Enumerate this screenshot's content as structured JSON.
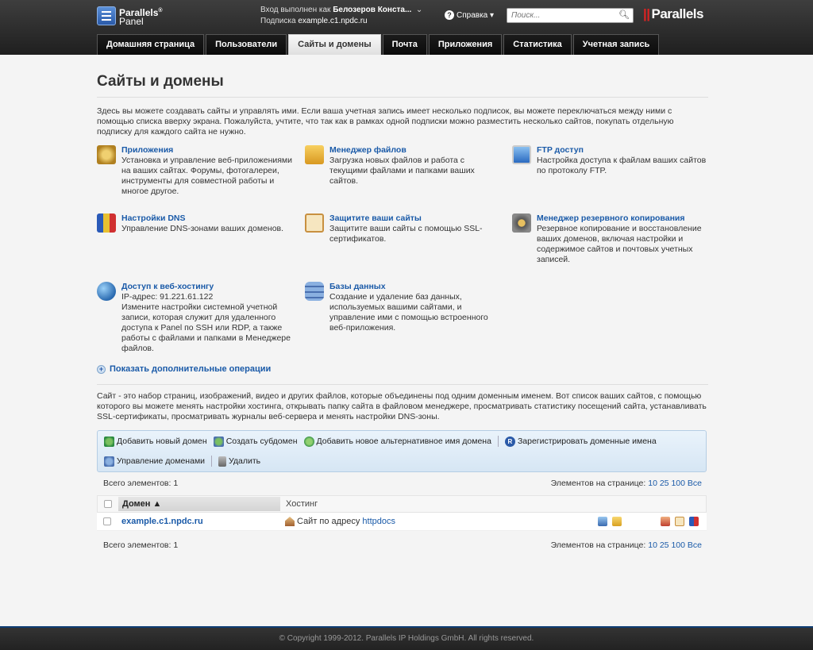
{
  "logo": {
    "line1": "Parallels",
    "sup": "®",
    "line2": "Panel"
  },
  "user": {
    "prefix": "Вход выполнен как",
    "name": "Белозеров Конста...",
    "subscription_label": "Подписка",
    "subscription_value": "example.c1.npdc.ru"
  },
  "help": {
    "label": "Справка"
  },
  "search": {
    "placeholder": "Поиск..."
  },
  "brand": {
    "name": "Parallels"
  },
  "tabs": [
    {
      "label": "Домашняя страница"
    },
    {
      "label": "Пользователи"
    },
    {
      "label": "Сайты и домены",
      "active": true
    },
    {
      "label": "Почта"
    },
    {
      "label": "Приложения"
    },
    {
      "label": "Статистика"
    },
    {
      "label": "Учетная запись"
    }
  ],
  "page": {
    "title": "Сайты и домены",
    "intro": "Здесь вы можете создавать сайты и управлять ими. Если ваша учетная запись имеет несколько подписок, вы можете переключаться между ними с помощью списка вверху экрана. Пожалуйста, учтите, что так как в рамках одной подписки можно разместить несколько сайтов, покупать отдельную подписку для каждого сайта не нужно."
  },
  "tools": [
    {
      "title": "Приложения",
      "desc": "Установка и управление веб-приложениями на ваших сайтах. Форумы, фотогалереи, инструменты для совместной работы и многое другое.",
      "icon": "gears-icon",
      "color": "#c8a040"
    },
    {
      "title": "Менеджер файлов",
      "desc": "Загрузка новых файлов и работа с текущими файлами и папками ваших сайтов.",
      "icon": "folders-icon",
      "color": "#e8b030"
    },
    {
      "title": "FTP доступ",
      "desc": "Настройка доступа к файлам ваших сайтов по протоколу FTP.",
      "icon": "ftp-monitor-icon",
      "color": "#4a8ad8"
    },
    {
      "title": "Настройки DNS",
      "desc": "Управление DNS-зонами ваших доменов.",
      "icon": "dns-flags-icon",
      "color": "#d04040"
    },
    {
      "title": "Защитите ваши сайты",
      "desc": "Защитите ваши сайты с помощью SSL-сертификатов.",
      "icon": "certificate-icon",
      "color": "#d8a050"
    },
    {
      "title": "Менеджер резервного копирования",
      "desc": "Резервное копирование и восстановление ваших доменов, включая настройки и содержимое сайтов и почтовых учетных записей.",
      "icon": "safe-icon",
      "color": "#777777"
    },
    {
      "title": "Доступ к веб-хостингу",
      "ip": "IP-адрес: 91.221.61.122",
      "desc": "Измените настройки системной учетной записи, которая служит для удаленного доступа к Panel по SSH или RDP, а также работы с файлами и папками в Менеджере файлов.",
      "icon": "globe-icon",
      "color": "#3a8ad0"
    },
    {
      "title": "Базы данных",
      "desc": "Создание и удаление баз данных, используемых вашими сайтами, и управление ими с помощью встроенного веб-приложения.",
      "icon": "database-icon",
      "color": "#5080c0"
    }
  ],
  "more_ops": "Показать дополнительные операции",
  "sites_desc": "Сайт - это набор страниц, изображений, видео и других файлов, которые объединены под одним доменным именем. Вот список ваших сайтов, с помощью которого вы можете менять настройки хостинга, открывать папку сайта в файловом менеджере, просматривать статистику посещений сайта, устанавливать SSL-сертификаты, просматривать журналы веб-сервера и менять настройки DNS-зоны.",
  "toolbar": {
    "add_domain": "Добавить новый домен",
    "create_subdomain": "Создать субдомен",
    "add_alias": "Добавить новое альтернативное имя домена",
    "register": "Зарегистрировать доменные имена",
    "manage": "Управление доменами",
    "delete": "Удалить"
  },
  "list": {
    "total": "Всего элементов: 1",
    "per_page_label": "Элементов на странице:",
    "per_page_options": [
      "10",
      "25",
      "100",
      "Все"
    ],
    "col_domain": "Домен",
    "col_hosting": "Хостинг",
    "rows": [
      {
        "domain": "example.c1.npdc.ru",
        "hosting_prefix": "Сайт по адресу",
        "hosting_link": "httpdocs"
      }
    ]
  },
  "footer": "© Copyright 1999-2012. Parallels IP Holdings GmbH. All rights reserved."
}
